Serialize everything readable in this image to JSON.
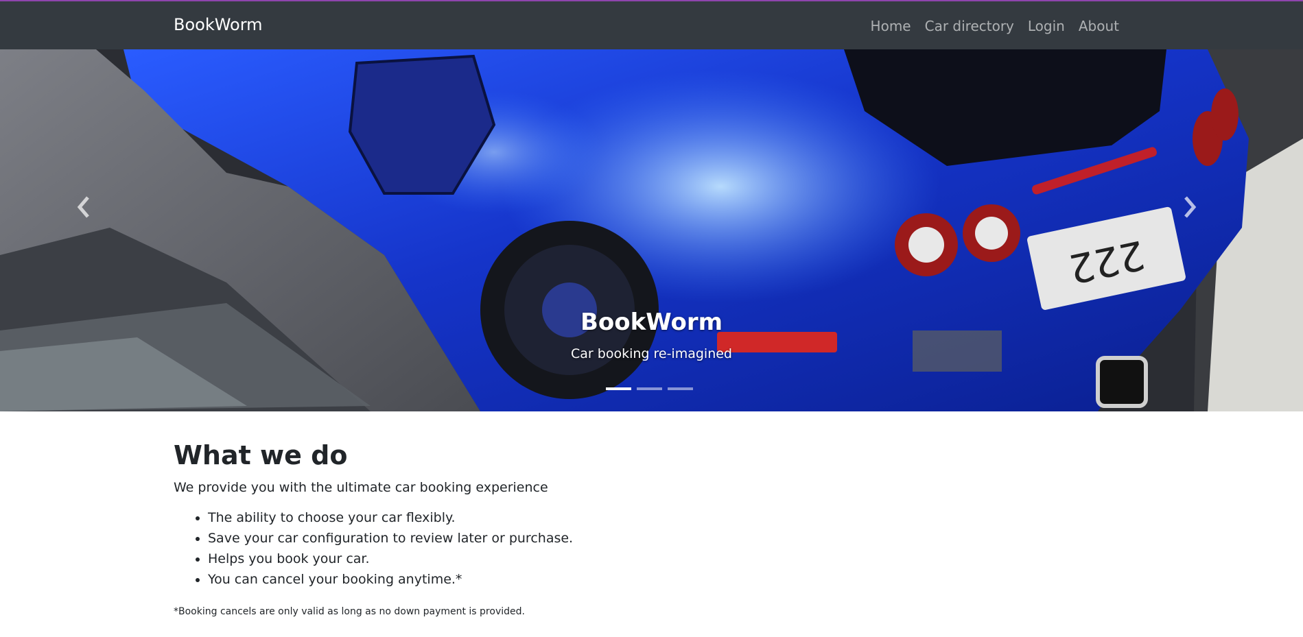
{
  "navbar": {
    "brand": "BookWorm",
    "links": [
      "Home",
      "Car directory",
      "Login",
      "About"
    ]
  },
  "carousel": {
    "title": "BookWorm",
    "subtitle": "Car booking re-imagined",
    "slide_count": 3,
    "active_slide": 1,
    "prev_icon": "chevron-left-icon",
    "next_icon": "chevron-right-icon"
  },
  "content": {
    "heading": "What we do",
    "lead": "We provide you with the ultimate car booking experience",
    "features": [
      "The ability to choose your car flexibly.",
      "Save your car configuration to review later or purchase.",
      "Helps you book your car.",
      "You can cancel your booking anytime.*"
    ],
    "footnote": "*Booking cancels are only valid as long as no down payment is provided."
  },
  "colors": {
    "navbar_bg": "#343a40",
    "accent_line": "#8e44ad",
    "car_blue": "#1a3fd6"
  }
}
